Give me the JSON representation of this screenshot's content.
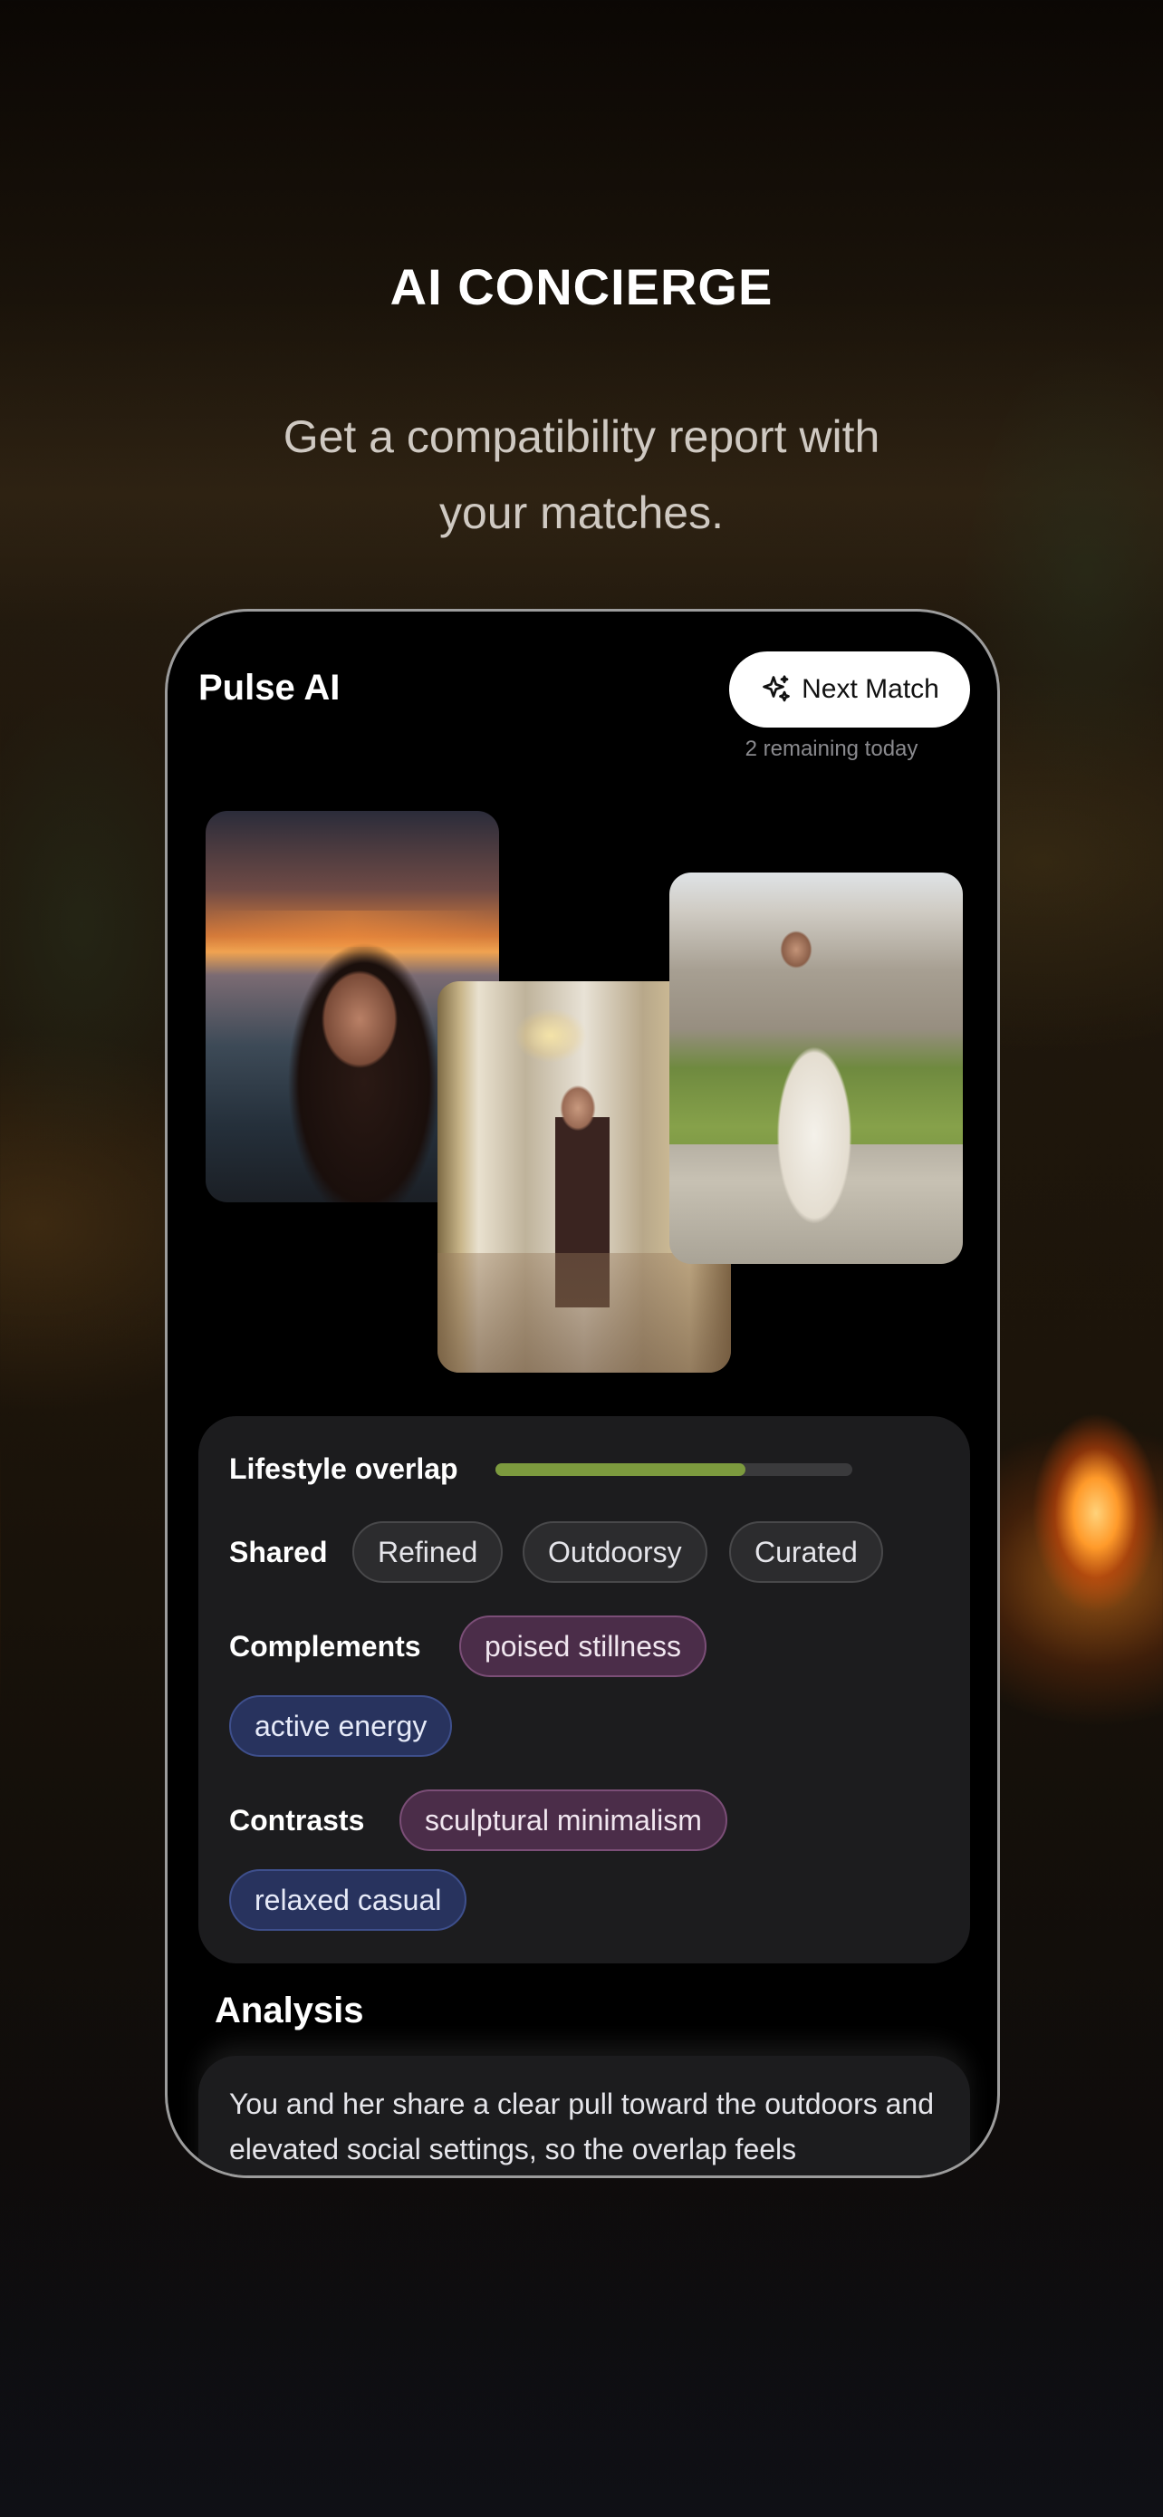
{
  "hero": {
    "title": "AI CONCIERGE",
    "subtitle": "Get a compatibility report with your matches."
  },
  "app": {
    "title": "Pulse AI",
    "next_match_label": "Next Match",
    "next_match_icon": "sparkle-icon",
    "remaining": "2 remaining today"
  },
  "photos": [
    "match-photo-beach-sunset",
    "match-photo-ballroom-mirror",
    "match-photo-estate-lawn"
  ],
  "report": {
    "lifestyle_label": "Lifestyle overlap",
    "lifestyle_overlap_fraction": 0.7,
    "accent_color": "#7c9a3e",
    "shared_label": "Shared",
    "shared_tags": [
      "Refined",
      "Outdoorsy",
      "Curated"
    ],
    "complements_label": "Complements",
    "complements_tags": [
      "poised stillness",
      "active energy"
    ],
    "contrasts_label": "Contrasts",
    "contrasts_tags": [
      "sculptural minimalism",
      "relaxed casual"
    ]
  },
  "analysis": {
    "title": "Analysis",
    "text": "You and her share a clear pull toward the outdoors and elevated social settings, so the overlap feels"
  }
}
